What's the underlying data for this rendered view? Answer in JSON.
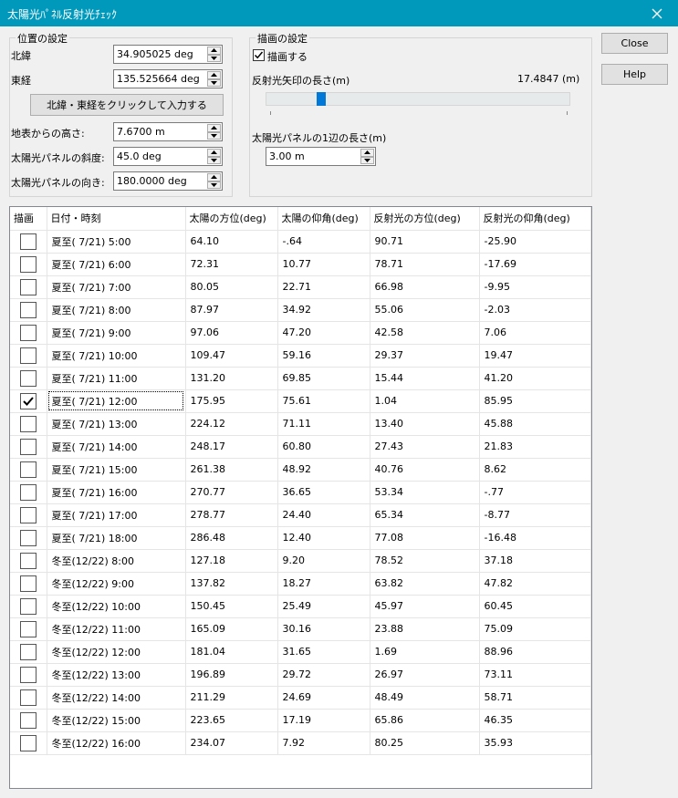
{
  "window": {
    "title": "太陽光ﾊﾟﾈﾙ反射光ﾁｪｯｸ"
  },
  "position": {
    "legend": "位置の設定",
    "lat_label": "北緯",
    "lat_value": "34.905025 deg",
    "lon_label": "東経",
    "lon_value": "135.525664 deg",
    "map_button": "北緯・東経をクリックして入力する",
    "height_label": "地表からの高さ:",
    "height_value": "7.6700 m",
    "tilt_label": "太陽光パネルの斜度:",
    "tilt_value": "45.0 deg",
    "azimuth_label": "太陽光パネルの向き:",
    "azimuth_value": "180.0000 deg"
  },
  "drawing": {
    "legend": "描画の設定",
    "draw_checkbox_label": "描画する",
    "draw_checked": true,
    "arrow_length_label": "反射光矢印の長さ(m)",
    "arrow_length_value": "17.4847 (m)",
    "panel_side_label": "太陽光パネルの1辺の長さ(m)",
    "panel_side_value": "3.00 m"
  },
  "buttons": {
    "close": "Close",
    "help": "Help"
  },
  "table": {
    "columns": [
      "描画",
      "日付・時刻",
      "太陽の方位(deg)",
      "太陽の仰角(deg)",
      "反射光の方位(deg)",
      "反射光の仰角(deg)"
    ],
    "rows": [
      {
        "checked": false,
        "datetime": "夏至( 7/21)  5:00",
        "sun_az": "64.10",
        "sun_el": "-.64",
        "ref_az": "90.71",
        "ref_el": "-25.90"
      },
      {
        "checked": false,
        "datetime": "夏至( 7/21)  6:00",
        "sun_az": "72.31",
        "sun_el": "10.77",
        "ref_az": "78.71",
        "ref_el": "-17.69"
      },
      {
        "checked": false,
        "datetime": "夏至( 7/21)  7:00",
        "sun_az": "80.05",
        "sun_el": "22.71",
        "ref_az": "66.98",
        "ref_el": "-9.95"
      },
      {
        "checked": false,
        "datetime": "夏至( 7/21)  8:00",
        "sun_az": "87.97",
        "sun_el": "34.92",
        "ref_az": "55.06",
        "ref_el": "-2.03"
      },
      {
        "checked": false,
        "datetime": "夏至( 7/21)  9:00",
        "sun_az": "97.06",
        "sun_el": "47.20",
        "ref_az": "42.58",
        "ref_el": "7.06"
      },
      {
        "checked": false,
        "datetime": "夏至( 7/21) 10:00",
        "sun_az": "109.47",
        "sun_el": "59.16",
        "ref_az": "29.37",
        "ref_el": "19.47"
      },
      {
        "checked": false,
        "datetime": "夏至( 7/21) 11:00",
        "sun_az": "131.20",
        "sun_el": "69.85",
        "ref_az": "15.44",
        "ref_el": "41.20"
      },
      {
        "checked": true,
        "datetime": "夏至( 7/21) 12:00",
        "sun_az": "175.95",
        "sun_el": "75.61",
        "ref_az": "1.04",
        "ref_el": "85.95"
      },
      {
        "checked": false,
        "datetime": "夏至( 7/21) 13:00",
        "sun_az": "224.12",
        "sun_el": "71.11",
        "ref_az": "13.40",
        "ref_el": "45.88"
      },
      {
        "checked": false,
        "datetime": "夏至( 7/21) 14:00",
        "sun_az": "248.17",
        "sun_el": "60.80",
        "ref_az": "27.43",
        "ref_el": "21.83"
      },
      {
        "checked": false,
        "datetime": "夏至( 7/21) 15:00",
        "sun_az": "261.38",
        "sun_el": "48.92",
        "ref_az": "40.76",
        "ref_el": "8.62"
      },
      {
        "checked": false,
        "datetime": "夏至( 7/21) 16:00",
        "sun_az": "270.77",
        "sun_el": "36.65",
        "ref_az": "53.34",
        "ref_el": "-.77"
      },
      {
        "checked": false,
        "datetime": "夏至( 7/21) 17:00",
        "sun_az": "278.77",
        "sun_el": "24.40",
        "ref_az": "65.34",
        "ref_el": "-8.77"
      },
      {
        "checked": false,
        "datetime": "夏至( 7/21) 18:00",
        "sun_az": "286.48",
        "sun_el": "12.40",
        "ref_az": "77.08",
        "ref_el": "-16.48"
      },
      {
        "checked": false,
        "datetime": "冬至(12/22)  8:00",
        "sun_az": "127.18",
        "sun_el": "9.20",
        "ref_az": "78.52",
        "ref_el": "37.18"
      },
      {
        "checked": false,
        "datetime": "冬至(12/22)  9:00",
        "sun_az": "137.82",
        "sun_el": "18.27",
        "ref_az": "63.82",
        "ref_el": "47.82"
      },
      {
        "checked": false,
        "datetime": "冬至(12/22) 10:00",
        "sun_az": "150.45",
        "sun_el": "25.49",
        "ref_az": "45.97",
        "ref_el": "60.45"
      },
      {
        "checked": false,
        "datetime": "冬至(12/22) 11:00",
        "sun_az": "165.09",
        "sun_el": "30.16",
        "ref_az": "23.88",
        "ref_el": "75.09"
      },
      {
        "checked": false,
        "datetime": "冬至(12/22) 12:00",
        "sun_az": "181.04",
        "sun_el": "31.65",
        "ref_az": "1.69",
        "ref_el": "88.96"
      },
      {
        "checked": false,
        "datetime": "冬至(12/22) 13:00",
        "sun_az": "196.89",
        "sun_el": "29.72",
        "ref_az": "26.97",
        "ref_el": "73.11"
      },
      {
        "checked": false,
        "datetime": "冬至(12/22) 14:00",
        "sun_az": "211.29",
        "sun_el": "24.69",
        "ref_az": "48.49",
        "ref_el": "58.71"
      },
      {
        "checked": false,
        "datetime": "冬至(12/22) 15:00",
        "sun_az": "223.65",
        "sun_el": "17.19",
        "ref_az": "65.86",
        "ref_el": "46.35"
      },
      {
        "checked": false,
        "datetime": "冬至(12/22) 16:00",
        "sun_az": "234.07",
        "sun_el": "7.92",
        "ref_az": "80.25",
        "ref_el": "35.93"
      }
    ]
  },
  "theme": {
    "titlebar": "#0099bc",
    "accent": "#0078d7"
  }
}
